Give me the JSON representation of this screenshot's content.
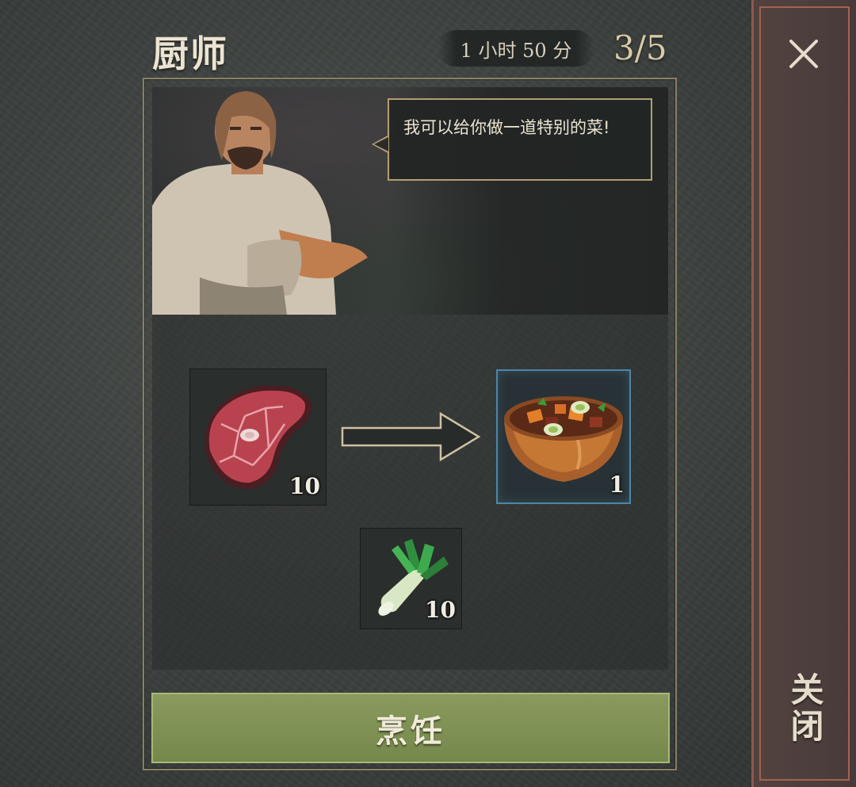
{
  "header": {
    "title": "厨师",
    "timer": "1 小时 50 分",
    "progress": "3/5"
  },
  "npc": {
    "dialogue": "我可以给你做一道特别的菜!"
  },
  "recipe": {
    "ingredients": [
      {
        "name": "meat-icon",
        "quantity": "10"
      },
      {
        "name": "leek-icon",
        "quantity": "10"
      }
    ],
    "result": {
      "name": "stew-icon",
      "quantity": "1"
    }
  },
  "actions": {
    "cook_label": "烹饪",
    "close_label": "关闭"
  },
  "colors": {
    "cook_button": "#7d8e52",
    "result_highlight": "#4d86a8",
    "close_panel": "#4f3f3d"
  }
}
